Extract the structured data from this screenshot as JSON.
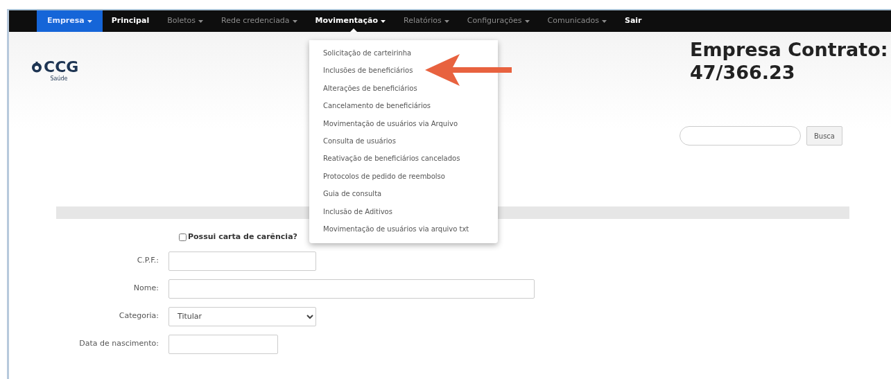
{
  "navbar": {
    "items": [
      {
        "label": "Empresa",
        "dropdown": true,
        "selected": true,
        "expanded": false
      },
      {
        "label": "Principal",
        "dropdown": false,
        "selected": false,
        "expanded": false
      },
      {
        "label": "Boletos",
        "dropdown": true,
        "selected": false,
        "expanded": false
      },
      {
        "label": "Rede credenciada",
        "dropdown": true,
        "selected": false,
        "expanded": false
      },
      {
        "label": "Movimentação",
        "dropdown": true,
        "selected": false,
        "expanded": true
      },
      {
        "label": "Relatórios",
        "dropdown": true,
        "selected": false,
        "expanded": false
      },
      {
        "label": "Configurações",
        "dropdown": true,
        "selected": false,
        "expanded": false
      },
      {
        "label": "Comunicados",
        "dropdown": true,
        "selected": false,
        "expanded": false
      },
      {
        "label": "Sair",
        "dropdown": false,
        "selected": false,
        "expanded": false
      }
    ]
  },
  "dropdown_menu": {
    "items": [
      "Solicitação de carteirinha",
      "Inclusões de beneficiários",
      "Alterações de beneficiários",
      "Cancelamento de beneficiários",
      "Movimentação de usuários via Arquivo",
      "Consulta de usuários",
      "Reativação de beneficiários cancelados",
      "Protocolos de pedido de reembolso",
      "Guia de consulta",
      "Inclusão de Aditivos",
      "Movimentação de usuários via arquivo txt"
    ]
  },
  "annotation": {
    "kind": "arrow"
  },
  "logo": {
    "name": "CCG",
    "subtitle": "Saúde"
  },
  "header": {
    "title": "Empresa Contrato:",
    "contract": "47/366.23"
  },
  "search": {
    "button": "Busca"
  },
  "form": {
    "checkbox": {
      "label": "Possui carta de carência?",
      "checked": false
    },
    "fields": [
      {
        "kind": "text",
        "label": "C.P.F.:"
      },
      {
        "kind": "text",
        "label": "Nome:"
      },
      {
        "kind": "select",
        "label": "Categoria:",
        "value": "Titular"
      },
      {
        "kind": "text",
        "label": "Data de nascimento:"
      }
    ]
  }
}
